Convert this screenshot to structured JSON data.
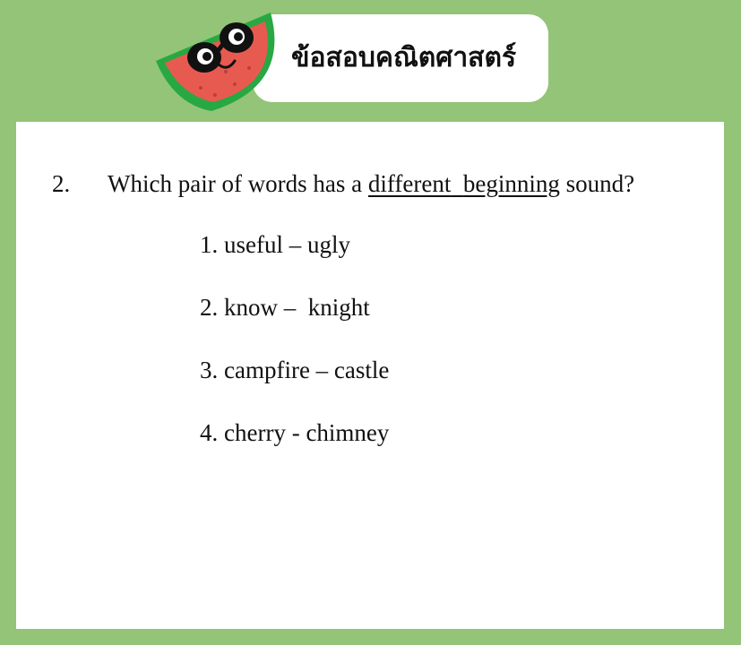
{
  "header": {
    "title": "ข้อสอบคณิตศาสตร์",
    "brand_color": "#93c477",
    "mascot_icon": "watermelon-mascot-icon"
  },
  "question": {
    "number": "2.",
    "text_before": "Which pair of words has a ",
    "underlined_1": "different",
    "gap": "  ",
    "underlined_2": "beginning",
    "text_after": " sound?",
    "options": [
      "1. useful – ugly",
      "2. know –  knight",
      "3. campfire – castle",
      "4. cherry - chimney"
    ]
  }
}
